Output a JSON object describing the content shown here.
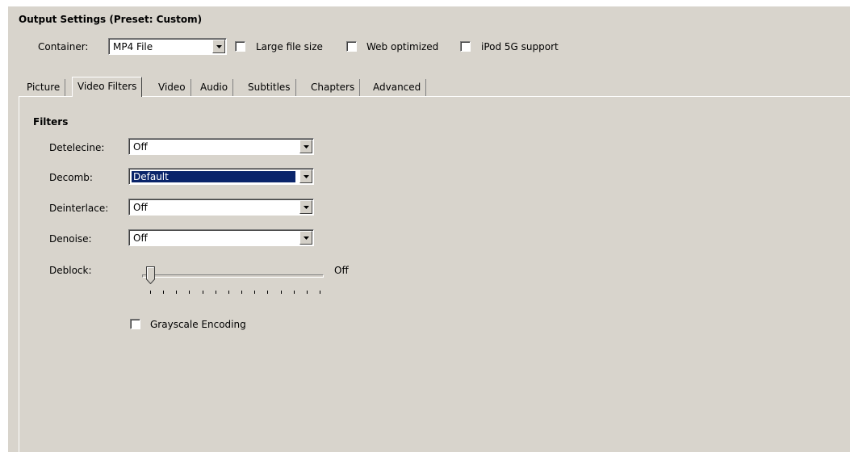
{
  "output_settings": {
    "title": "Output Settings (Preset: Custom)",
    "container_label": "Container:",
    "container_value": "MP4 File",
    "large_file_label": "Large file size",
    "web_optimized_label": "Web optimized",
    "ipod_label": "iPod 5G support"
  },
  "tabs": [
    {
      "label": "Picture"
    },
    {
      "label": "Video Filters"
    },
    {
      "label": "Video"
    },
    {
      "label": "Audio"
    },
    {
      "label": "Subtitles"
    },
    {
      "label": "Chapters"
    },
    {
      "label": "Advanced"
    }
  ],
  "active_tab": "Video Filters",
  "filters": {
    "heading": "Filters",
    "detelecine_label": "Detelecine:",
    "detelecine_value": "Off",
    "decomb_label": "Decomb:",
    "decomb_value": "Default",
    "deinterlace_label": "Deinterlace:",
    "deinterlace_value": "Off",
    "denoise_label": "Denoise:",
    "denoise_value": "Off",
    "deblock_label": "Deblock:",
    "deblock_value": "Off",
    "deblock_level": 0,
    "grayscale_label": "Grayscale Encoding"
  },
  "colors": {
    "window_bg": "#d8d4cc",
    "selection_bg": "#0a246a",
    "selection_fg": "#ffffff"
  }
}
